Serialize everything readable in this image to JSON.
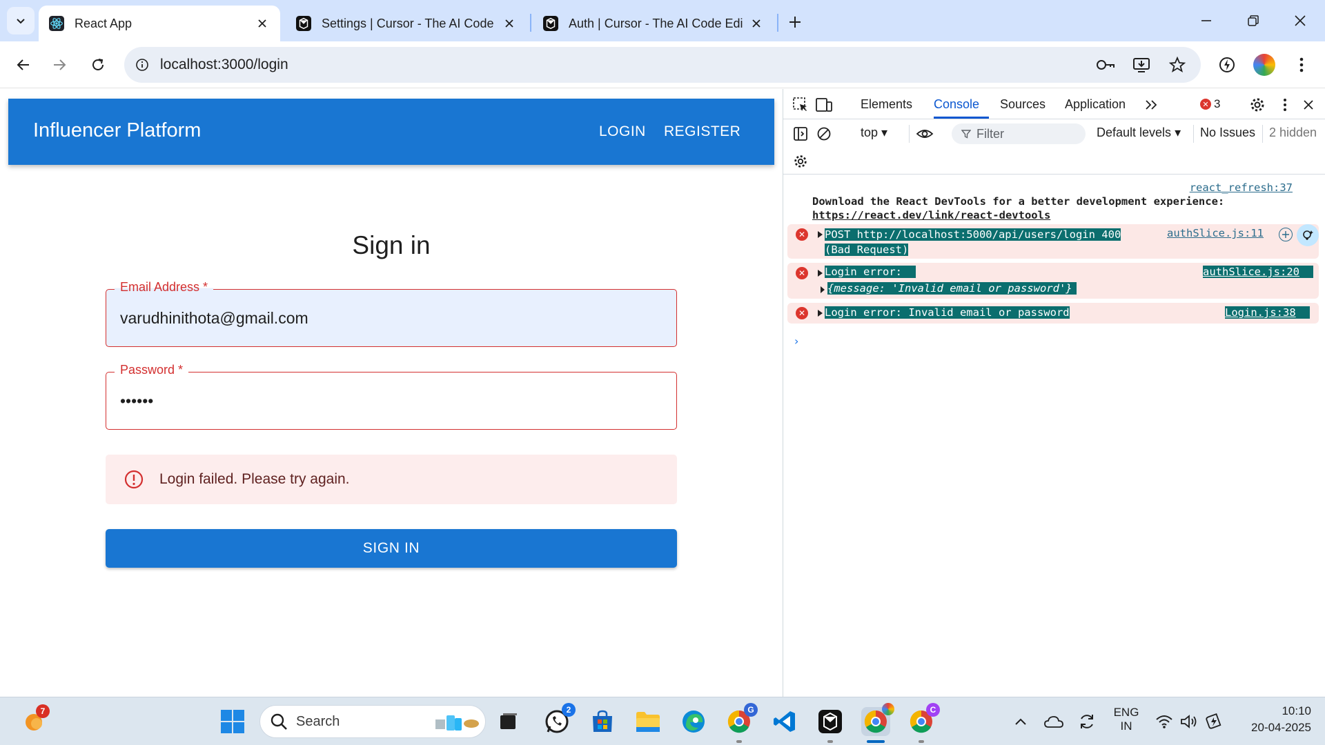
{
  "browser": {
    "tabs": [
      {
        "title": "React App",
        "active": true,
        "icon": "react-icon"
      },
      {
        "title": "Settings | Cursor - The AI Code Editor",
        "active": false,
        "icon": "cursor-icon"
      },
      {
        "title": "Auth | Cursor - The AI Code Editor",
        "active": false,
        "icon": "cursor-icon"
      }
    ],
    "url": "localhost:3000/login"
  },
  "app": {
    "brand": "Influencer Platform",
    "nav": {
      "login": "LOGIN",
      "register": "REGISTER"
    },
    "form": {
      "title": "Sign in",
      "email": {
        "label": "Email Address *",
        "value": "varudhinithota@gmail.com"
      },
      "password": {
        "label": "Password *",
        "value": "••••••"
      },
      "alert": "Login failed. Please try again.",
      "submit": "SIGN IN"
    },
    "colors": {
      "primary": "#1976d2",
      "error": "#d32f2f",
      "alert_bg": "#fdeded"
    }
  },
  "devtools": {
    "tabs": [
      "Elements",
      "Console",
      "Sources",
      "Application"
    ],
    "active_tab": "Console",
    "error_count": "3",
    "context": "top",
    "filter_placeholder": "Filter",
    "levels": "Default levels",
    "issues": "No Issues",
    "hidden": "2 hidden",
    "console": {
      "info": {
        "source": "react_refresh:37",
        "text": "Download the React DevTools for a better development experience:",
        "link": "https://react.dev/link/react-devtools"
      },
      "errors": [
        {
          "method": "POST",
          "url": "http://localhost:5000/api/users/login",
          "status": "400",
          "status_text": "(Bad Request)",
          "source": "authSlice.js:11"
        },
        {
          "text": "Login error:",
          "detail": "{message: 'Invalid email or password'}",
          "source": "authSlice.js:20"
        },
        {
          "text": "Login error: Invalid email or password",
          "source": "Login.js:38"
        }
      ]
    }
  },
  "taskbar": {
    "search_placeholder": "Search",
    "badges": {
      "weather": "7",
      "whatsapp": "2",
      "chrome_g": "G",
      "chrome_c": "C"
    },
    "lang_top": "ENG",
    "lang_bottom": "IN",
    "time": "10:10",
    "date": "20-04-2025"
  }
}
